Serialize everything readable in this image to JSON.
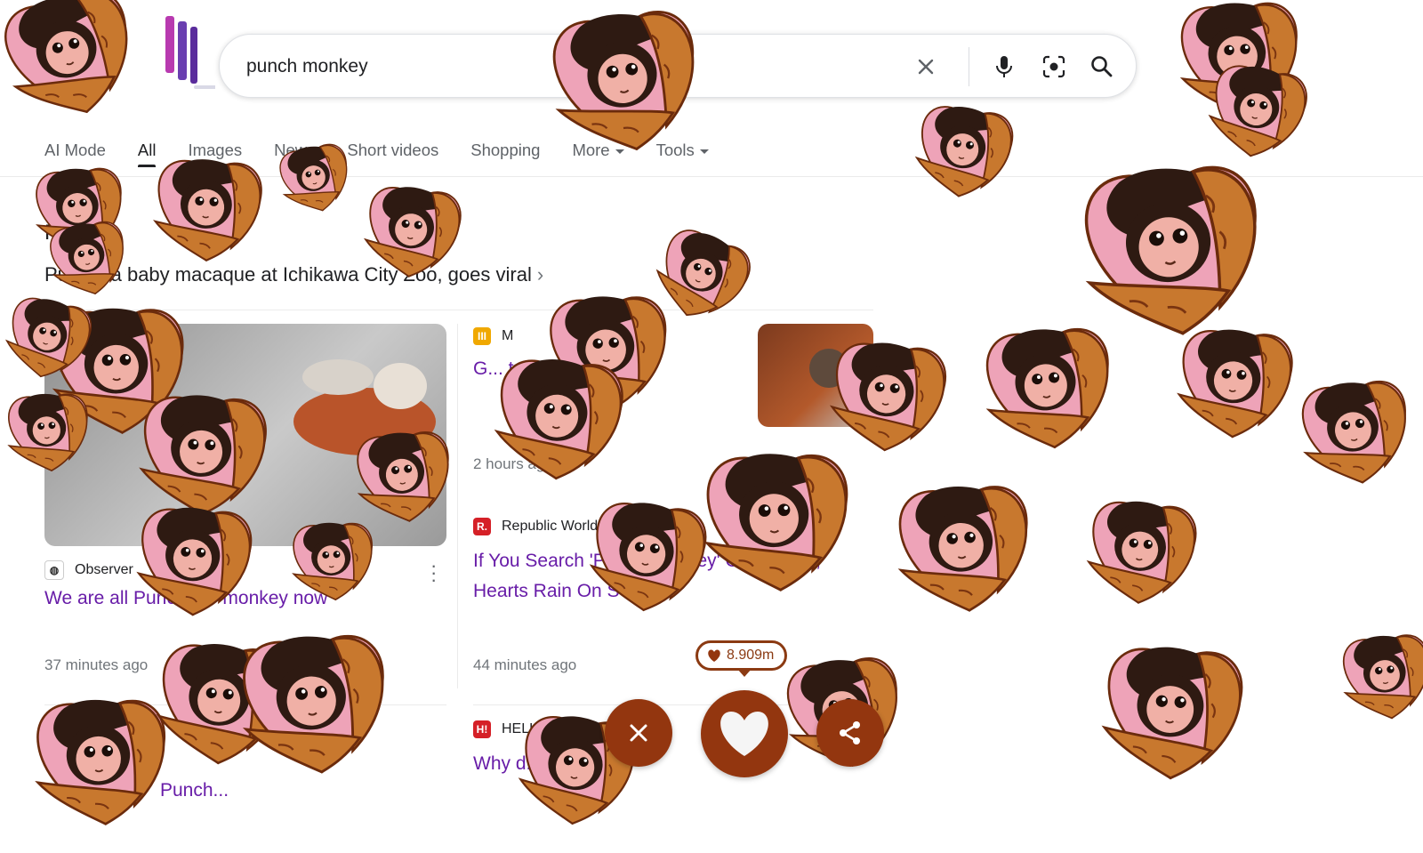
{
  "search": {
    "query": "punch monkey",
    "clear_label": "Clear",
    "voice_label": "Search by voice",
    "lens_label": "Search by image",
    "submit_label": "Google Search"
  },
  "tabs": [
    {
      "label": "AI Mode"
    },
    {
      "label": "All"
    },
    {
      "label": "Images"
    },
    {
      "label": "News"
    },
    {
      "label": "Short videos"
    },
    {
      "label": "Shopping"
    },
    {
      "label": "More"
    },
    {
      "label": "Tools"
    }
  ],
  "top_stories": {
    "title": "Punch",
    "subtitle": "Punch, a baby macaque at Ichikawa City Zoo, goes viral",
    "stories": [
      {
        "source": "Observer",
        "title": "We are all Punch the monkey now",
        "time": "37 minutes ago"
      },
      {
        "source": "M",
        "title": "G... t... o... million...",
        "time": "2 hours ago"
      },
      {
        "source": "Republic World",
        "title": "If You Search 'Punch Monkey' On Google, Hearts Rain On Screen",
        "time": "44 minutes ago"
      },
      {
        "source": "HELLO!",
        "title": "Why d..."
      },
      {
        "title": "Punch..."
      }
    ]
  },
  "overlay": {
    "count": "8.909m",
    "close_label": "Close",
    "like_label": "Like",
    "share_label": "Share"
  },
  "colors": {
    "link_visited": "#681da8",
    "button_brown": "#93360f",
    "heart_pink": "#eea3b8",
    "heart_tan": "#c8782e"
  }
}
